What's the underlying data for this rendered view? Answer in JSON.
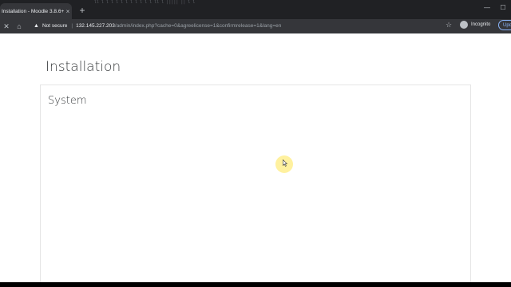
{
  "browser": {
    "tab_title": "Installation - Moodle 3.8.6+ (Bui",
    "tab_close": "×",
    "new_tab": "+",
    "faint_text": "ll  l  l  l  l   l    l l  l    l  l  l ll  l  ||||| ||  l l",
    "window_controls": {
      "minimize": "—",
      "maximize": "☐",
      "close": "✕"
    },
    "nav": {
      "back": "←",
      "forward": "→",
      "reload": "✕",
      "home": "⌂"
    },
    "security_label": "Not secure",
    "separator": "|",
    "url_host": "132.145.227.203",
    "url_path": "/admin/index.php?cache=0&agreelicense=1&confirmrelease=1&lang=en",
    "bookmark_icon": "☆",
    "incognito_label": "Incognito",
    "update_label": "Upd"
  },
  "page": {
    "heading": "Installation",
    "card_title": "System"
  },
  "colors": {
    "chrome_dark": "#202124",
    "toolbar": "#35363a",
    "page_bg": "#ffffff",
    "text": "#373a3c",
    "update_accent": "#8ab4f8",
    "cursor_highlight": "#ffe650"
  }
}
